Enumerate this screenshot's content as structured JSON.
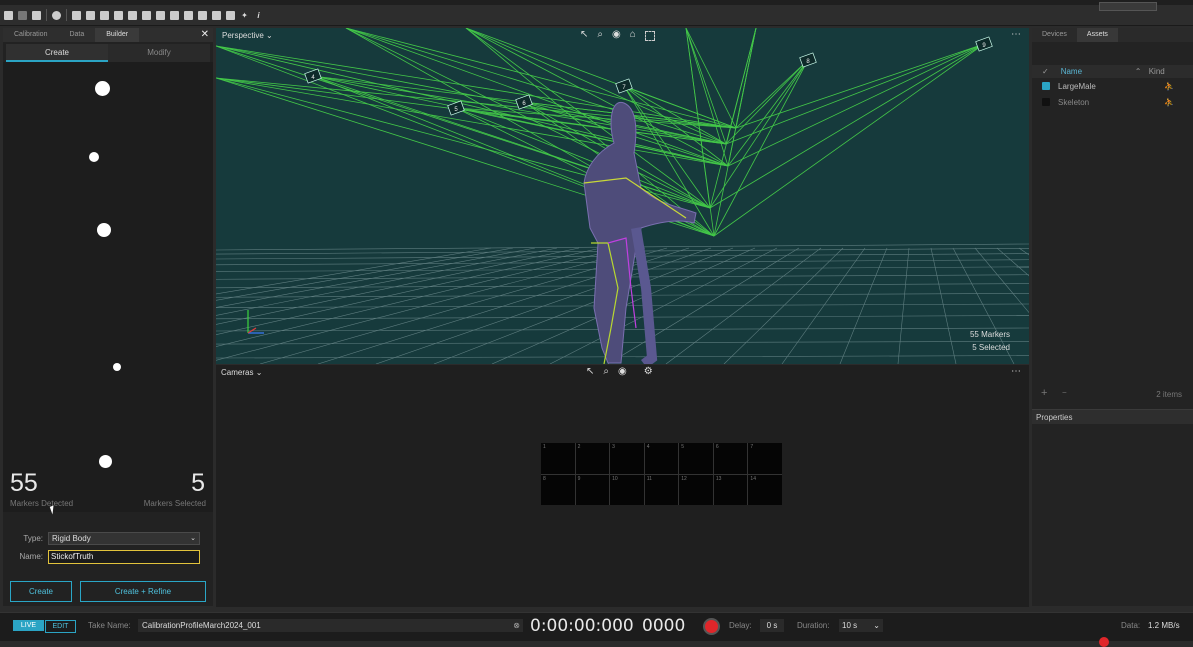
{
  "left_panel": {
    "tabs": [
      "Calibration",
      "Data",
      "Builder"
    ],
    "close_icon": "close-icon",
    "subtabs": [
      "Create",
      "Modify"
    ],
    "markers_detected_value": "55",
    "markers_detected_label": "Markers Detected",
    "markers_selected_value": "5",
    "markers_selected_label": "Markers Selected",
    "type_label": "Type:",
    "type_value": "Rigid Body",
    "name_label": "Name:",
    "name_value": "StickofTruth",
    "create_button": "Create",
    "create_refine_button": "Create + Refine"
  },
  "viewport": {
    "view_name": "Perspective",
    "markers_count": "55 Markers",
    "selected_count": "5 Selected",
    "camera_labels": [
      "4",
      "5",
      "6",
      "7",
      "8",
      "9"
    ],
    "more_icon": "more-icon"
  },
  "cameras_view": {
    "label": "Cameras",
    "thumbnail_labels": [
      "1",
      "2",
      "3",
      "4",
      "5",
      "6",
      "7",
      "8",
      "9",
      "10",
      "11",
      "12",
      "13",
      "14"
    ]
  },
  "right_panel": {
    "tabs": [
      "Devices",
      "Assets"
    ],
    "columns": [
      "Name",
      "Kind"
    ],
    "assets": [
      {
        "name": "LargeMale",
        "checked": true
      },
      {
        "name": "Skeleton",
        "checked": false
      }
    ],
    "item_count": "2 items",
    "properties_title": "Properties"
  },
  "bottom_bar": {
    "live_label": "LIVE",
    "edit_label": "EDIT",
    "take_name_label": "Take Name:",
    "take_name_value": "CalibrationProfileMarch2024_001",
    "timecode": "0:00:00:000",
    "frame": "0000",
    "delay_label": "Delay:",
    "delay_value": "0 s",
    "duration_label": "Duration:",
    "duration_value": "10 s",
    "data_label": "Data:",
    "data_value": "1.2 MB/s"
  },
  "colors": {
    "accent": "#2ba4c4",
    "record": "#e0262a",
    "viewport_bg": "#163a3c",
    "ray_green": "#4be04b",
    "name_field_border": "#e2c33c"
  }
}
